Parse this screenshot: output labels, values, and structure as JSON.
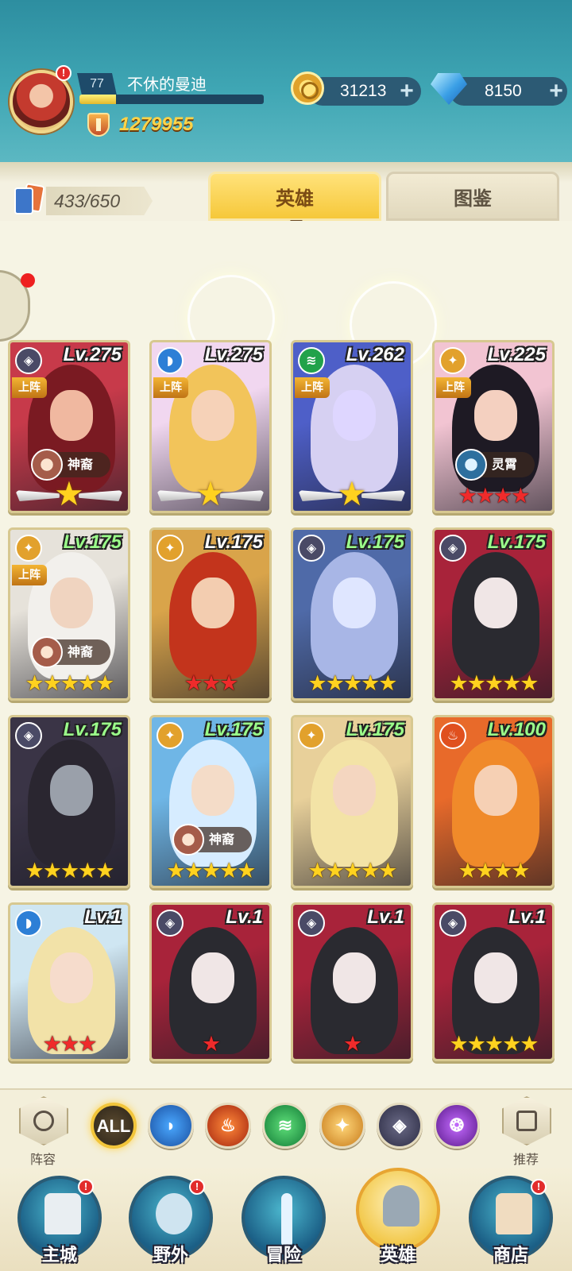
{
  "player": {
    "level": "77",
    "name": "不休的曼迪",
    "xp_fraction": 0.2,
    "power": "1279955"
  },
  "currency": {
    "gold": "31213",
    "diamonds": "8150",
    "plus": "+"
  },
  "notification_badge": "!",
  "tabs": {
    "card_count": "433/650",
    "heroes": "英雄",
    "codex": "图鉴"
  },
  "heroes": [
    {
      "level": "Lv.275",
      "element": "shadow",
      "deployed": "上阵",
      "faction": "神裔",
      "stars": "wings",
      "level_color": "white"
    },
    {
      "level": "Lv.275",
      "element": "water",
      "deployed": "上阵",
      "faction": "",
      "stars": "wings",
      "level_color": "white"
    },
    {
      "level": "Lv.262",
      "element": "wind",
      "deployed": "上阵",
      "faction": "",
      "stars": "wings",
      "level_color": "white"
    },
    {
      "level": "Lv.225",
      "element": "light",
      "deployed": "上阵",
      "faction": "灵霄",
      "stars": "★★★★",
      "star_color": "red",
      "level_color": "white"
    },
    {
      "level": "Lv.175",
      "element": "light",
      "deployed": "上阵",
      "faction": "神裔",
      "stars": "★★★★★",
      "star_color": "gold",
      "level_color": "green"
    },
    {
      "level": "Lv.175",
      "element": "light",
      "deployed": "",
      "faction": "",
      "stars": "★★★",
      "star_color": "red",
      "level_color": "white"
    },
    {
      "level": "Lv.175",
      "element": "shadow",
      "deployed": "",
      "faction": "",
      "stars": "★★★★★",
      "star_color": "gold",
      "level_color": "green"
    },
    {
      "level": "Lv.175",
      "element": "shadow",
      "deployed": "",
      "faction": "",
      "stars": "★★★★★",
      "star_color": "gold",
      "level_color": "green"
    },
    {
      "level": "Lv.175",
      "element": "shadow",
      "deployed": "",
      "faction": "",
      "stars": "★★★★★",
      "star_color": "gold",
      "level_color": "green"
    },
    {
      "level": "Lv.175",
      "element": "light",
      "deployed": "",
      "faction": "神裔",
      "stars": "★★★★★",
      "star_color": "gold",
      "level_color": "green"
    },
    {
      "level": "Lv.175",
      "element": "light",
      "deployed": "",
      "faction": "",
      "stars": "★★★★★",
      "star_color": "gold",
      "level_color": "green"
    },
    {
      "level": "Lv.100",
      "element": "fire",
      "deployed": "",
      "faction": "",
      "stars": "★★★★",
      "star_color": "gold",
      "level_color": "green"
    },
    {
      "level": "Lv.1",
      "element": "water",
      "deployed": "",
      "faction": "",
      "stars": "★★★",
      "star_color": "red",
      "level_color": "white"
    },
    {
      "level": "Lv.1",
      "element": "shadow",
      "deployed": "",
      "faction": "",
      "stars": "★",
      "star_color": "red",
      "level_color": "white"
    },
    {
      "level": "Lv.1",
      "element": "shadow",
      "deployed": "",
      "faction": "",
      "stars": "★",
      "star_color": "red",
      "level_color": "white"
    },
    {
      "level": "Lv.1",
      "element": "shadow",
      "deployed": "",
      "faction": "",
      "stars": "★★★★★",
      "star_color": "gold",
      "level_color": "white"
    }
  ],
  "filters": {
    "lineup_label": "阵容",
    "recommend_label": "推荐",
    "all_label": "ALL",
    "elements": [
      "water",
      "fire",
      "wind",
      "light",
      "shadow",
      "arcane"
    ]
  },
  "nav": {
    "main_city": "主城",
    "wild": "野外",
    "adventure": "冒险",
    "heroes": "英雄",
    "shop": "商店"
  },
  "colors": {
    "accent_gold": "#f6c83a",
    "header_teal": "#3fa6b4",
    "star_gold": "#ffd21f",
    "star_red": "#ef2b2b"
  }
}
